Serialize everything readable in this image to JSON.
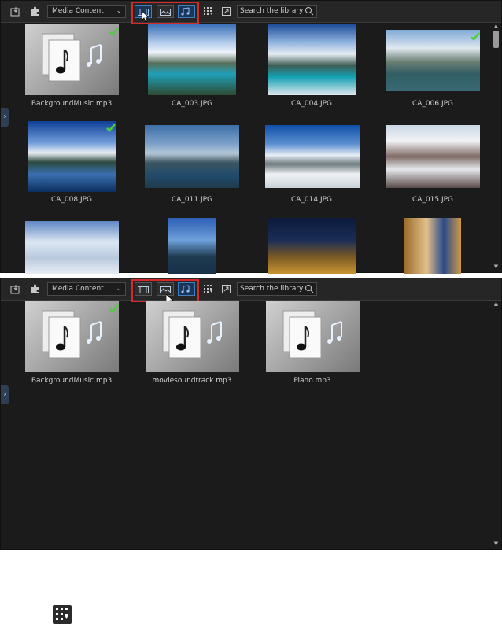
{
  "toolbar": {
    "dropdown_label": "Media Content",
    "search_placeholder": "Search the library",
    "import_icon": "import-media-icon",
    "plugin_icon": "plugin-icon",
    "filter_video_icon": "filmstrip-icon",
    "filter_image_icon": "landscape-image-icon",
    "filter_audio_icon": "music-notes-icon",
    "view_icon": "grid-view-icon",
    "expand_icon": "expand-icon"
  },
  "colors": {
    "accent": "#3f7fbf",
    "highlight_box": "#d62a2a",
    "check": "#4ccf3a",
    "panel_bg": "#1b1b1b"
  },
  "panel_top": {
    "tiles": [
      {
        "name": "BackgroundMusic.mp3",
        "kind": "audio",
        "checked": true
      },
      {
        "name": "CA_003.JPG",
        "kind": "photo",
        "checked": false
      },
      {
        "name": "CA_004.JPG",
        "kind": "photo",
        "checked": false
      },
      {
        "name": "CA_006.JPG",
        "kind": "photo",
        "checked": true
      },
      {
        "name": "CA_008.JPG",
        "kind": "photo",
        "checked": true
      },
      {
        "name": "CA_011.JPG",
        "kind": "photo",
        "checked": false
      },
      {
        "name": "CA_014.JPG",
        "kind": "photo",
        "checked": false
      },
      {
        "name": "CA_015.JPG",
        "kind": "photo",
        "checked": false
      }
    ]
  },
  "panel_bottom": {
    "tiles": [
      {
        "name": "BackgroundMusic.mp3",
        "kind": "audio",
        "checked": true
      },
      {
        "name": "moviesoundtrack.mp3",
        "kind": "audio",
        "checked": false
      },
      {
        "name": "Piano.mp3",
        "kind": "audio",
        "checked": false
      }
    ]
  },
  "footer_icon": "grid-sort-icon"
}
